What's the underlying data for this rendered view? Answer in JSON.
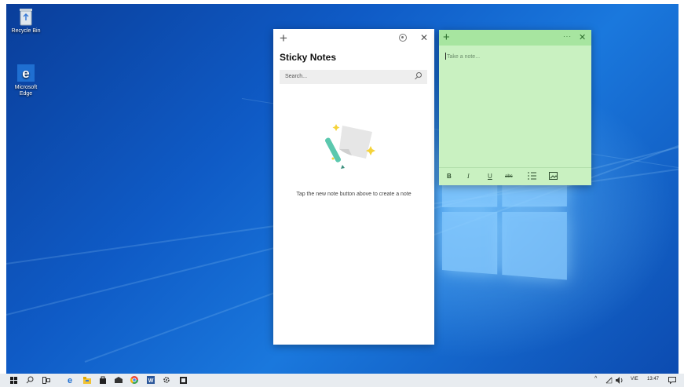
{
  "desktop": {
    "icons": [
      {
        "label": "Recycle Bin",
        "icon": "recycle-bin-icon"
      },
      {
        "label": "Microsoft Edge",
        "icon": "edge-icon"
      }
    ]
  },
  "sticky_list": {
    "title": "Sticky Notes",
    "search_placeholder": "Search...",
    "empty_message": "Tap the new note button above to create a note",
    "colors": {
      "accent": "#5bc8ae"
    }
  },
  "note": {
    "placeholder": "Take a note...",
    "color": "#c9f1c1",
    "header_color": "#a7e5a0",
    "toolbar": {
      "bold": "B",
      "italic": "I",
      "underline": "U",
      "strikethrough": "abc",
      "bullets_icon": "list-icon",
      "image_icon": "image-icon"
    }
  },
  "taskbar": {
    "icons": [
      "windows-start-icon",
      "search-icon",
      "task-view-icon",
      "edge-icon",
      "file-explorer-icon",
      "store-icon",
      "mail-icon",
      "chrome-icon",
      "word-icon",
      "settings-icon",
      "sticky-notes-icon"
    ],
    "tray": {
      "language": "VIE",
      "time": "13:47"
    }
  }
}
